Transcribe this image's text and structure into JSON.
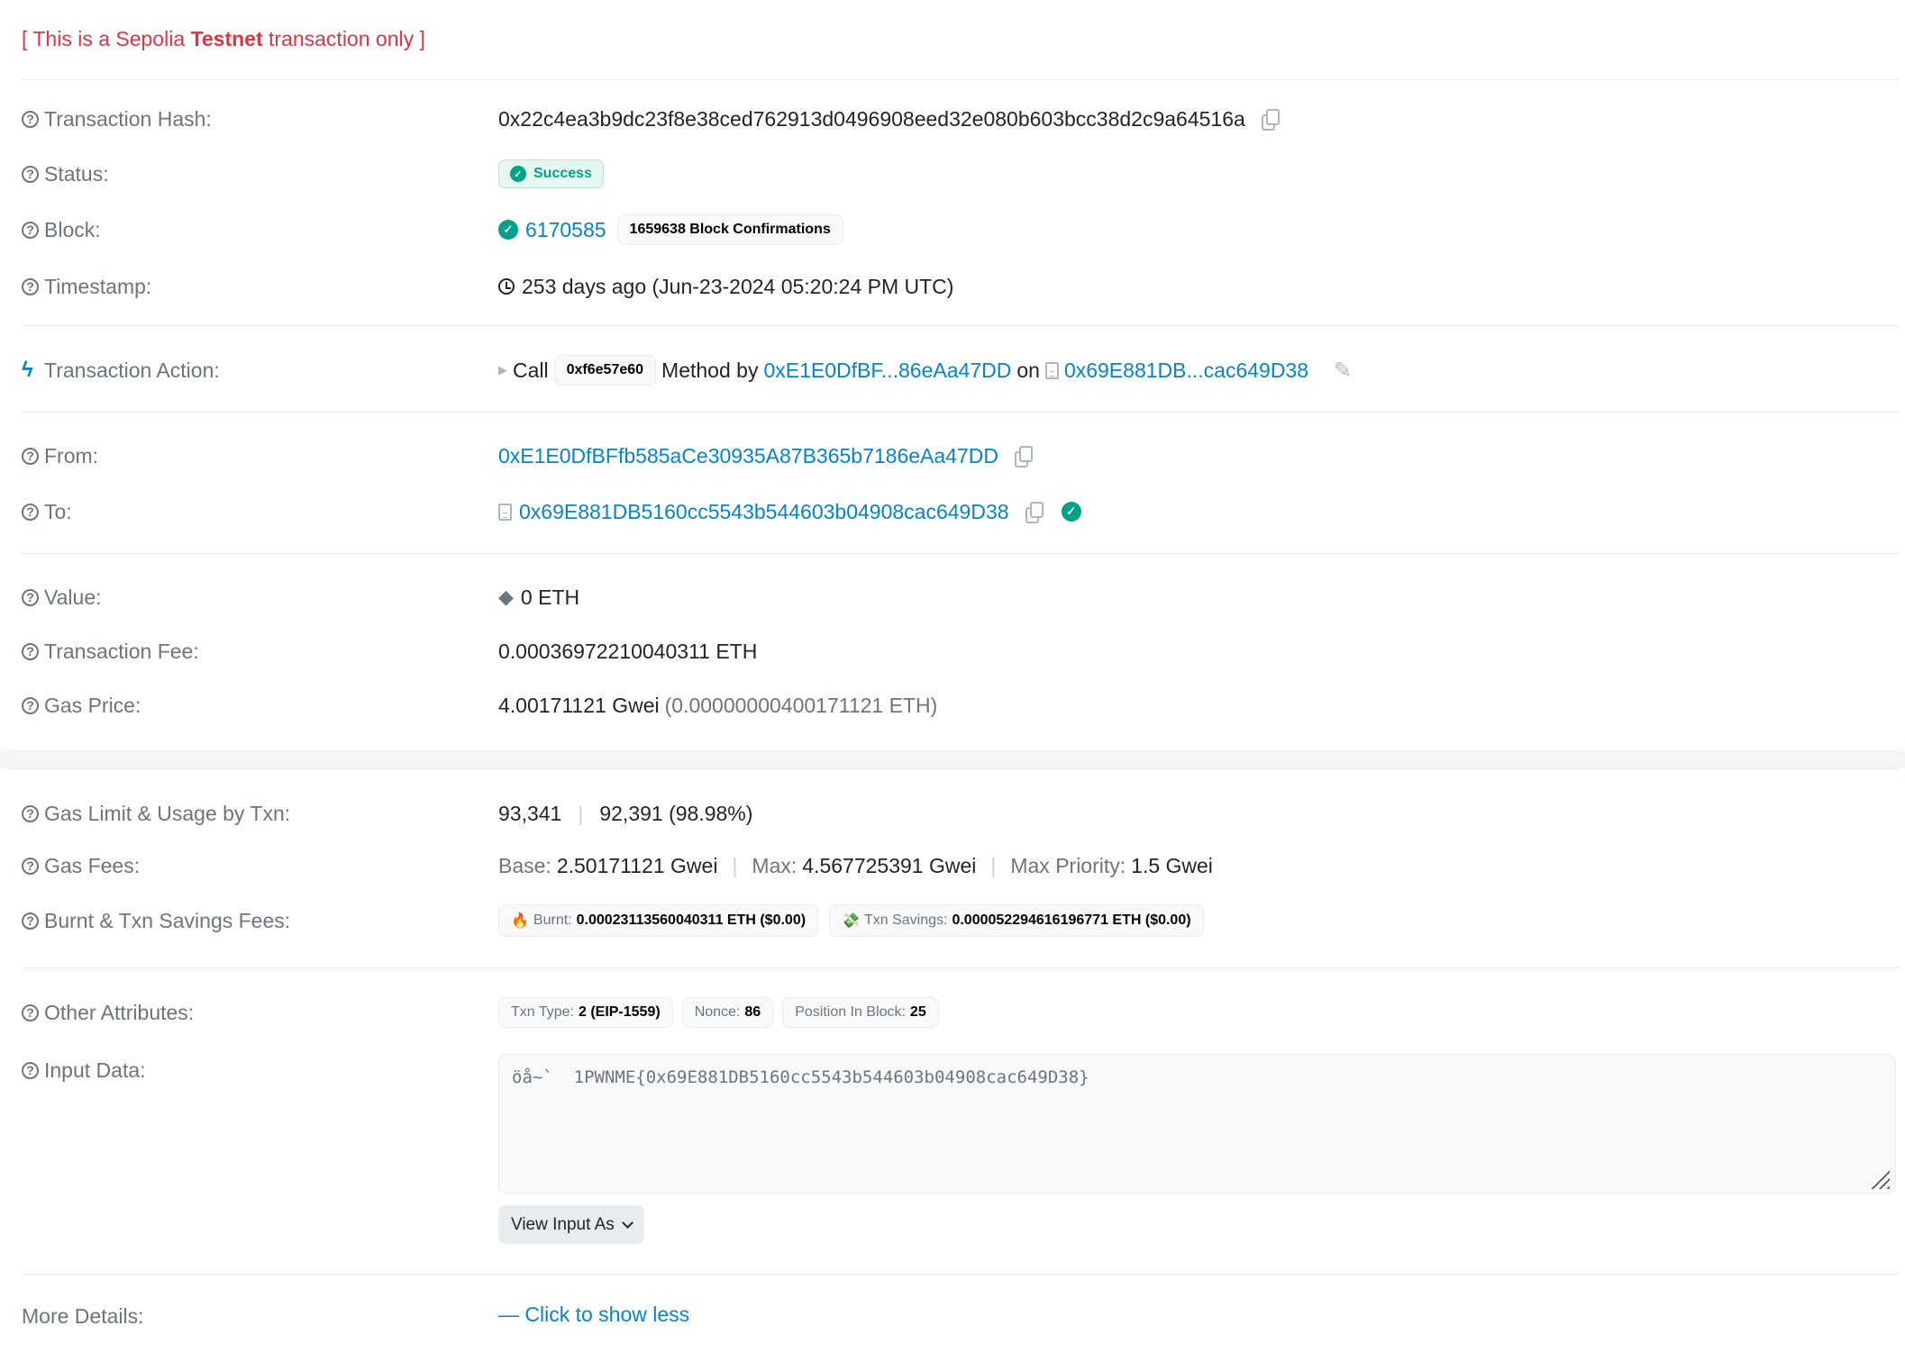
{
  "notice": {
    "prefix": "[ This is a Sepolia ",
    "bold": "Testnet",
    "suffix": " transaction only ]"
  },
  "overview": {
    "tx_hash": {
      "label": "Transaction Hash:",
      "value": "0x22c4ea3b9dc23f8e38ced762913d0496908eed32e080b603bcc38d2c9a64516a"
    },
    "status": {
      "label": "Status:",
      "value": "Success"
    },
    "block": {
      "label": "Block:",
      "value": "6170585",
      "confirmations": "1659638 Block Confirmations"
    },
    "timestamp": {
      "label": "Timestamp:",
      "value": "253 days ago (Jun-23-2024 05:20:24 PM UTC)"
    },
    "action": {
      "label": "Transaction Action:",
      "call": "Call",
      "method_id": "0xf6e57e60",
      "method_by": "Method by",
      "from_short": "0xE1E0DfBF...86eAa47DD",
      "on": "on",
      "to_short": "0x69E881DB...cac649D38"
    },
    "from": {
      "label": "From:",
      "value": "0xE1E0DfBFfb585aCe30935A87B365b7186eAa47DD"
    },
    "to": {
      "label": "To:",
      "value": "0x69E881DB5160cc5543b544603b04908cac649D38"
    },
    "value": {
      "label": "Value:",
      "value": "0 ETH"
    },
    "fee": {
      "label": "Transaction Fee:",
      "value": "0.00036972210040311 ETH"
    },
    "gas_price": {
      "label": "Gas Price:",
      "value": "4.00171121 Gwei",
      "eth": "(0.00000000400171121 ETH)"
    }
  },
  "more": {
    "gas_limit": {
      "label": "Gas Limit & Usage by Txn:",
      "limit": "93,341",
      "used": "92,391 (98.98%)"
    },
    "gas_fees": {
      "label": "Gas Fees:",
      "base_k": "Base:",
      "base_v": "2.50171121 Gwei",
      "max_k": "Max:",
      "max_v": "4.567725391 Gwei",
      "prio_k": "Max Priority:",
      "prio_v": "1.5 Gwei"
    },
    "burnt": {
      "label": "Burnt & Txn Savings Fees:",
      "burnt_k": "Burnt:",
      "burnt_v": "0.00023113560040311 ETH ($0.00)",
      "savings_k": "Txn Savings:",
      "savings_v": "0.000052294616196771 ETH ($0.00)"
    },
    "other": {
      "label": "Other Attributes:",
      "type_k": "Txn Type:",
      "type_v": "2 (EIP-1559)",
      "nonce_k": "Nonce:",
      "nonce_v": "86",
      "pos_k": "Position In Block:",
      "pos_v": "25"
    },
    "input": {
      "label": "Input Data:",
      "value": "öå~`  1PWNME{0x69E881DB5160cc5543b544603b04908cac649D38}",
      "view_as": "View Input As"
    },
    "more_details": {
      "label": "More Details:",
      "toggle": "— Click to show less"
    }
  },
  "colors": {
    "link": "#0784c3",
    "success": "#00a186",
    "notice": "#dc3545",
    "muted": "#6c757d"
  }
}
